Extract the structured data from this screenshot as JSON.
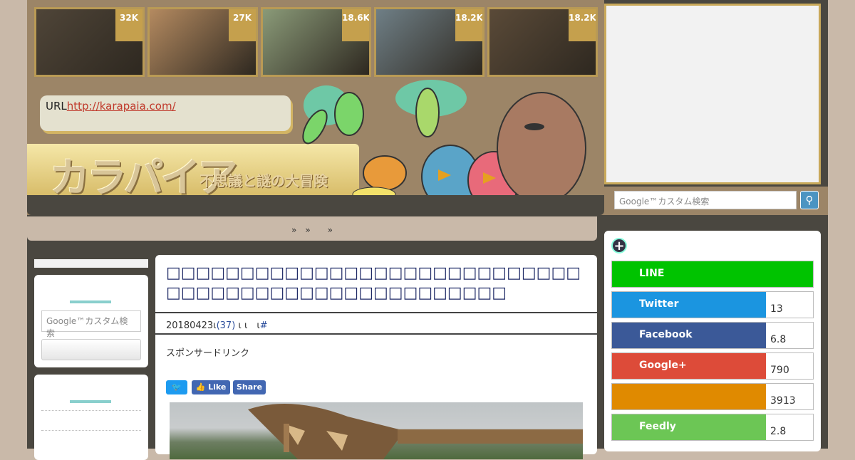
{
  "thumbs": [
    {
      "count": "32K",
      "color": "#4f4538"
    },
    {
      "count": "27K",
      "color": "#b48a60"
    },
    {
      "count": "18.6K",
      "color": "#8a9a78"
    },
    {
      "count": "18.2K",
      "color": "#6f7f86"
    },
    {
      "count": "18.2K",
      "color": "#5a4a38"
    }
  ],
  "url": {
    "label": "URL",
    "link": "http://karapaia.com/"
  },
  "logo": {
    "main": "カラパイア",
    "sub": "不思議と謎の大冒険"
  },
  "breadcrumb": "»　»　　»",
  "search": {
    "placeholder": "Google™カスタム検索",
    "icon": "search-icon"
  },
  "left_search": {
    "placeholder": "Google™カスタム検索"
  },
  "article": {
    "title": "□□□□□□□□□□□□□□□□□□□□□□□□□□□□□□□□□□□□□□□□□□□□□□□□□□□",
    "date": "20180423",
    "meta_mid": "ι",
    "comments": "(37)",
    "meta_end": "ι ι　ι",
    "hash": "#",
    "sponsor": "スポンサードリンク",
    "buttons": {
      "twitter": "🐦",
      "like": "👍 Like",
      "share": "Share"
    }
  },
  "share_panel": [
    {
      "name": "LINE",
      "count": "",
      "color": "#00c300",
      "full": true
    },
    {
      "name": "Twitter",
      "count": "13",
      "color": "#1b95e0",
      "full": false
    },
    {
      "name": "Facebook",
      "count": "6.8",
      "color": "#3b5998",
      "full": false
    },
    {
      "name": "Google+",
      "count": "790",
      "color": "#dd4b39",
      "full": false
    },
    {
      "name": "",
      "count": "3913",
      "color": "#e08a00",
      "full": false
    },
    {
      "name": "Feedly",
      "count": "2.8",
      "color": "#6cc655",
      "full": false
    }
  ]
}
